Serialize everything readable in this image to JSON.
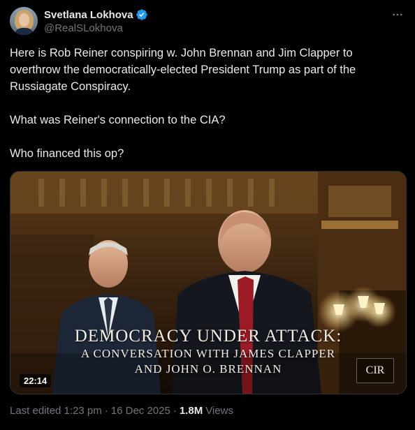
{
  "author": {
    "name": "Svetlana Lokhova",
    "handle": "@RealSLokhova",
    "verified": true,
    "verified_color": "#1d9bf0"
  },
  "more_icon": "more-horizontal-icon",
  "tweet": {
    "paragraphs": [
      "Here is Rob Reiner conspiring w. John Brennan and Jim Clapper to overthrow the democratically-elected President Trump as part of the Russiagate Conspiracy.",
      "What was Reiner's connection to the CIA?",
      "Who financed this op?"
    ]
  },
  "media": {
    "title_line1": "DEMOCRACY UNDER ATTACK:",
    "title_line2": "A CONVERSATION WITH JAMES CLAPPER",
    "title_line3": "AND JOHN O. BRENNAN",
    "duration": "22:14",
    "logo": "CIR"
  },
  "meta": {
    "edited": "Last edited 1:23 pm",
    "date": "16 Dec 2025",
    "views_count": "1.8M",
    "views_label": "Views",
    "separator": "·"
  },
  "colors": {
    "background": "#000000",
    "text": "#e7e9ea",
    "secondary": "#71767b"
  }
}
